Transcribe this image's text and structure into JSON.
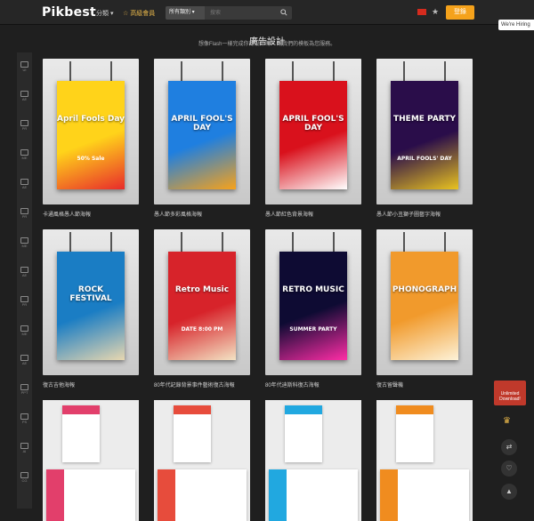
{
  "header": {
    "logo": "Pikbest",
    "categories": "分類 ▾",
    "premium": "☆ 高級會員",
    "search_type": "所有類別 ▾",
    "search_placeholder": "搜索",
    "login": "登錄",
    "hiring": "We're Hiring"
  },
  "sidebar": [
    "UI",
    "AE",
    "PR",
    "ME",
    "AE",
    "PR",
    "ME",
    "AE",
    "PR",
    "ME",
    "AE",
    "PPT",
    "PS",
    "AI",
    "CG"
  ],
  "page": {
    "title": "廣告設計",
    "subtitle": "想像Flash一樣完成你的設計嗎？ 讓我們的模板為您服務。"
  },
  "cards": [
    {
      "caption": "卡通風格愚人節海報",
      "colors": [
        "#ffd31a",
        "#e82b2b"
      ],
      "headline": "April Fools Day",
      "extra": "50% Sale"
    },
    {
      "caption": "愚人節多彩風格海報",
      "colors": [
        "#1f7fe0",
        "#f7a21b"
      ],
      "headline": "APRIL FOOL'S DAY",
      "extra": ""
    },
    {
      "caption": "愚人節紅色背景海報",
      "colors": [
        "#d9111c",
        "#ffffff"
      ],
      "headline": "APRIL FOOL'S DAY",
      "extra": ""
    },
    {
      "caption": "愚人節小丑獅子圖藝字海報",
      "colors": [
        "#2a0d4a",
        "#e9c320"
      ],
      "headline": "THEME PARTY",
      "extra": "APRIL FOOLS' DAY"
    },
    {
      "caption": "復古吉他海報",
      "colors": [
        "#1a7dc4",
        "#e8d7b0"
      ],
      "headline": "ROCK FESTIVAL",
      "extra": ""
    },
    {
      "caption": "80年代記錄背景事件藝術復古海報",
      "colors": [
        "#d7232a",
        "#f3e3c4"
      ],
      "headline": "Retro Music",
      "extra": "DATE 8:00 PM"
    },
    {
      "caption": "80年代迪斯科復古海報",
      "colors": [
        "#0e0b33",
        "#ff2da6"
      ],
      "headline": "RETRO MUSIC",
      "extra": "SUMMER PARTY"
    },
    {
      "caption": "復古留聲機",
      "colors": [
        "#f19a2c",
        "#fdf2d8"
      ],
      "headline": "PHONOGRAPH",
      "extra": ""
    }
  ],
  "brochures": [
    {
      "colors": [
        "#e23f6b",
        "#ffffff"
      ]
    },
    {
      "colors": [
        "#e74c3c",
        "#ffffff"
      ]
    },
    {
      "colors": [
        "#21a8e0",
        "#ffffff"
      ]
    },
    {
      "colors": [
        "#f08c1f",
        "#ffffff"
      ]
    }
  ],
  "float": {
    "unlimited": "Unlimited Download!",
    "crown": "♛",
    "share": "⇄",
    "fav": "♡",
    "top": "▲"
  }
}
